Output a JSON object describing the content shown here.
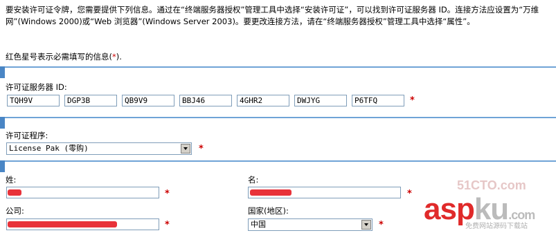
{
  "intro_text": "要安装许可证令牌，您需要提供下列信息。通过在“终端服务器授权”管理工具中选择“安装许可证”，可以找到许可证服务器 ID。连接方法应设置为“万维网”(Windows 2000)或“Web 浏览器”(Windows Server 2003)。要更改连接方法，请在“终端服务器授权”管理工具中选择“属性”。",
  "required_note": {
    "prefix": "红色星号表示必需填写的信息(",
    "star": "*",
    "suffix": ")."
  },
  "license_server": {
    "label": "许可证服务器 ID:",
    "segments": [
      "TQH9V",
      "DGP3B",
      "QB9V9",
      "BBJ46",
      "4GHR2",
      "DWJYG",
      "P6TFQ"
    ]
  },
  "license_program": {
    "label": "许可证程序:",
    "selected": "License Pak (零购)"
  },
  "last_name": {
    "label": "姓:",
    "value": ""
  },
  "first_name": {
    "label": "名:",
    "value": ""
  },
  "company": {
    "label": "公司:",
    "value": ""
  },
  "country": {
    "label": "国家(地区):",
    "selected": "中国"
  },
  "required_star": "*",
  "watermark": {
    "top": "51CTO.com",
    "asp": "asp",
    "ku": "ku",
    "tld": ".com",
    "sub": "免费网站源码下载站"
  },
  "colors": {
    "accent_bar": "#6fa3d6",
    "required": "#cc0000",
    "redaction": "#e8323a"
  }
}
